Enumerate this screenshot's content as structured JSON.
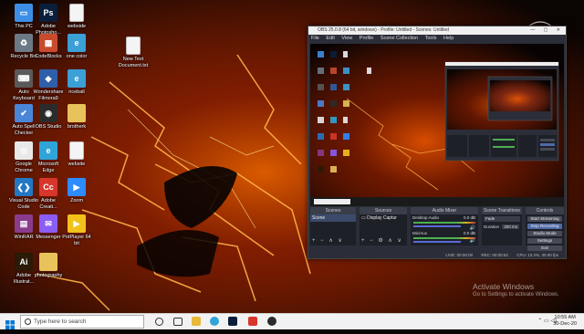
{
  "desktop_icons": [
    {
      "id": "this-pc",
      "label": "This PC",
      "color": "#3d8ee6",
      "glyph": "▭"
    },
    {
      "id": "adobe-photoshop",
      "label": "Adobe Photosho...",
      "color": "#0b1e3b",
      "glyph": "Ps"
    },
    {
      "id": "webside",
      "label": "webside",
      "color": "#f4f4f4",
      "glyph": "",
      "doc": true
    },
    {
      "id": "recycle-bin",
      "label": "Recycle Bin",
      "color": "#6c7a86",
      "glyph": "♻"
    },
    {
      "id": "codeblocks",
      "label": "CodeBlocks",
      "color": "#c94b2e",
      "glyph": "▦"
    },
    {
      "id": "one-color",
      "label": "one color",
      "color": "#3aa0d6",
      "glyph": "e"
    },
    {
      "id": "new-text-document",
      "label": "New Text Document.txt",
      "color": "#f4f4f4",
      "glyph": "",
      "doc": true
    },
    {
      "id": "auto-keyboard",
      "label": "Auto Keyboard",
      "color": "#5a5a5a",
      "glyph": "⌨"
    },
    {
      "id": "wondershare",
      "label": "Wondershare Filmora9",
      "color": "#2f5fa8",
      "glyph": "◆"
    },
    {
      "id": "riceball",
      "label": "riceball",
      "color": "#3aa0d6",
      "glyph": "e"
    },
    {
      "id": "auto-spell-checker",
      "label": "Auto Spell Checker",
      "color": "#4a86d8",
      "glyph": "✔"
    },
    {
      "id": "obs-studio",
      "label": "OBS Studio",
      "color": "#2b2b2b",
      "glyph": "◉"
    },
    {
      "id": "brother",
      "label": "brotherk",
      "color": "#e8c35b",
      "glyph": "",
      "folder": true
    },
    {
      "id": "google-chrome",
      "label": "Google Chrome",
      "color": "#e8e8e8",
      "glyph": "◎"
    },
    {
      "id": "microsoft-edge",
      "label": "Microsoft Edge",
      "color": "#2fa4d8",
      "glyph": "e"
    },
    {
      "id": "website",
      "label": "website",
      "color": "#f4f4f4",
      "glyph": "",
      "doc": true
    },
    {
      "id": "visual-studio-code",
      "label": "Visual Studio Code",
      "color": "#2378c4",
      "glyph": "❮❯"
    },
    {
      "id": "adobe-creative",
      "label": "Adobe Creati...",
      "color": "#d8362b",
      "glyph": "Cc"
    },
    {
      "id": "zoom",
      "label": "Zoom",
      "color": "#2d8cff",
      "glyph": "▶"
    },
    {
      "id": "winrar",
      "label": "WinRAR",
      "color": "#8a3c8c",
      "glyph": "▤"
    },
    {
      "id": "messenger",
      "label": "Messenger",
      "color": "#8b5cf6",
      "glyph": "✉"
    },
    {
      "id": "potplayer",
      "label": "PotPlayer 64 bit",
      "color": "#f2c21b",
      "glyph": "▶"
    },
    {
      "id": "adobe-illustrator",
      "label": "Adobe Illustrat...",
      "color": "#2a1a06",
      "glyph": "Ai"
    },
    {
      "id": "photography",
      "label": "photography",
      "color": "#e8c35b",
      "glyph": "",
      "folder": true
    }
  ],
  "obs": {
    "title": "OBS 25.0.8 (64 bit, windows) - Profile: Untitled - Scenes: Untitled",
    "menu": [
      "File",
      "Edit",
      "View",
      "Profile",
      "Scene Collection",
      "Tools",
      "Help"
    ],
    "docks": {
      "scenes": {
        "header": "Scenes",
        "items": [
          "Scene"
        ]
      },
      "sources": {
        "header": "Sources",
        "items": [
          "Display Captur"
        ]
      },
      "mixer": {
        "header": "Audio Mixer",
        "tracks": [
          {
            "name": "Desktop Audio",
            "level": "0.0 dB"
          },
          {
            "name": "Mic/Aux",
            "level": "0.0 dB"
          }
        ]
      },
      "transitions": {
        "header": "Scene Transitions",
        "type": "Fade",
        "duration_label": "Duration",
        "duration": "300 ms"
      },
      "controls": {
        "header": "Controls",
        "buttons": [
          "Start Streaming",
          "Stop Recording",
          "Studio Mode",
          "Settings",
          "Exit"
        ]
      }
    },
    "status": {
      "live": "LIVE: 00:00:00",
      "rec": "REC: 00:00:52",
      "cpu": "CPU: 13.2%, 30.00 fps"
    }
  },
  "watermark": {
    "line1": "Activate Windows",
    "line2": "Go to Settings to activate Windows."
  },
  "logo_text": "riceballs",
  "taskbar": {
    "search_placeholder": "Type here to search",
    "time": "10:55 AM",
    "date": "30-Dec-20"
  }
}
